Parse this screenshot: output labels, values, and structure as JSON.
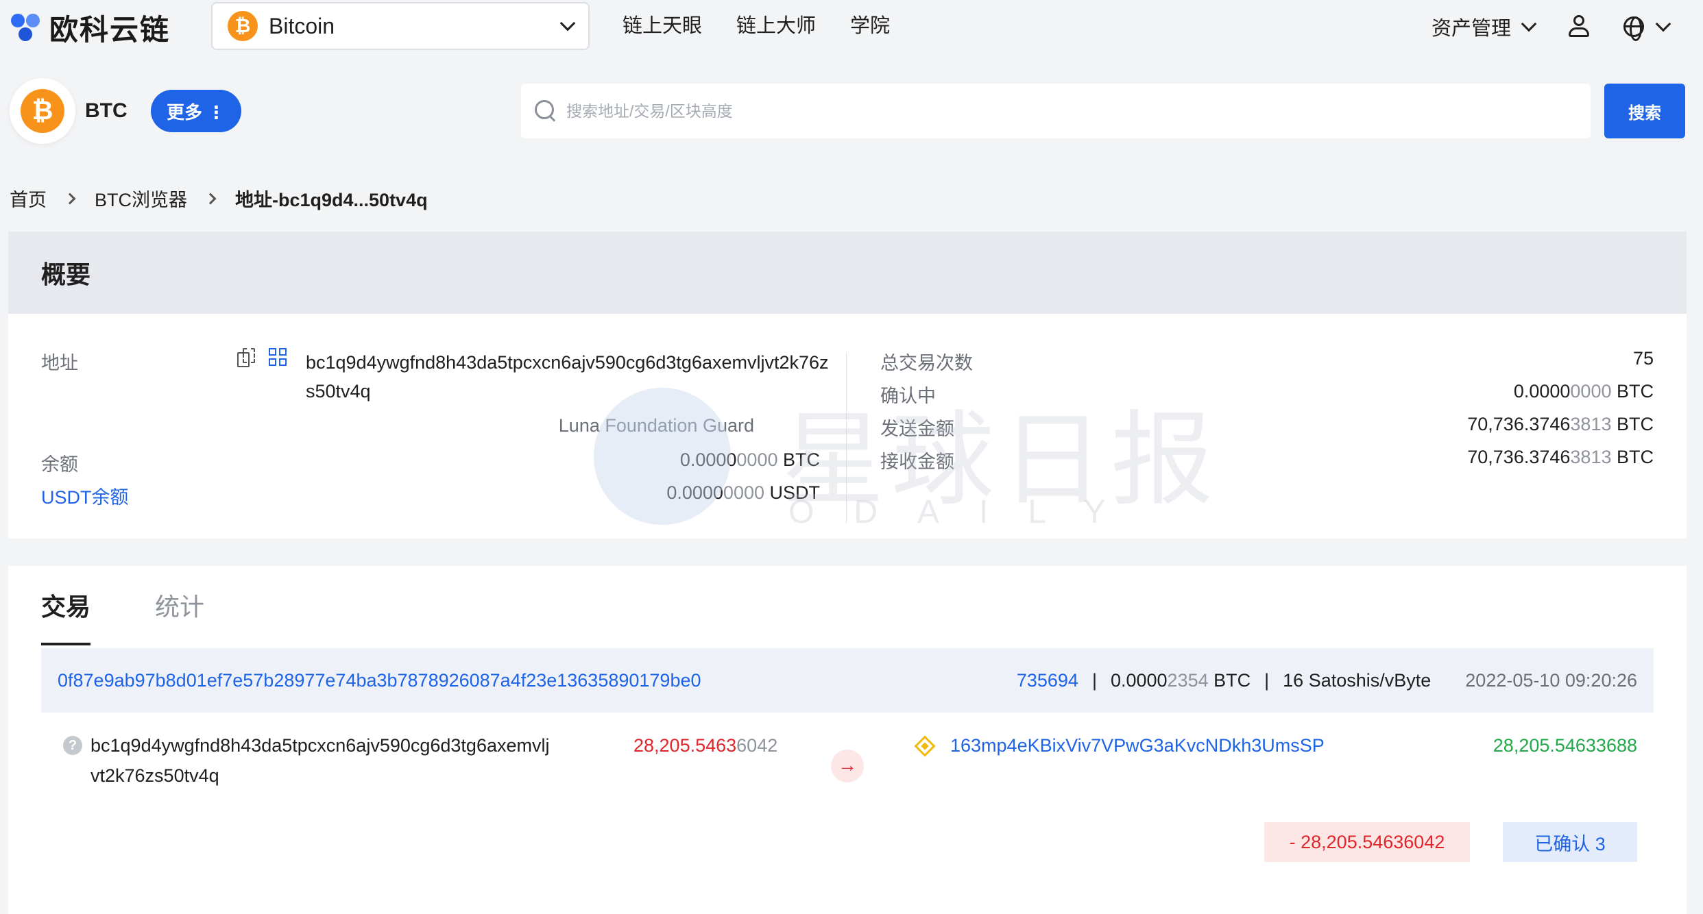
{
  "topbar": {
    "logo_text": "欧科云链",
    "chain_select": {
      "coin_glyph": "₿",
      "value": "Bitcoin"
    },
    "nav": [
      "链上天眼",
      "链上大师",
      "学院"
    ],
    "asset_mgmt": "资产管理"
  },
  "coin": {
    "glyph": "₿",
    "symbol": "BTC",
    "more_label": "更多 ⋮"
  },
  "search": {
    "placeholder": "搜索地址/交易/区块高度",
    "button_label": "搜索"
  },
  "breadcrumb": [
    "首页",
    "BTC浏览器",
    "地址-bc1q9d4...50tv4q"
  ],
  "overview": {
    "title": "概要",
    "address_label": "地址",
    "address": "bc1q9d4ywgfnd8h43da5tpcxcn6ajv590cg6d3tg6axemvljvt2k76zs50tv4q",
    "tag": "Luna Foundation Guard",
    "balance_label": "余额",
    "usdt_balance_label": "USDT余额",
    "balance_btc": {
      "main": "0.0000",
      "dim": "0000",
      "unit": " BTC"
    },
    "balance_usdt": {
      "main": "0.0000",
      "dim": "0000",
      "unit": " USDT"
    },
    "stats": [
      {
        "label": "总交易次数",
        "main": "75",
        "dim": "",
        "unit": ""
      },
      {
        "label": "确认中",
        "main": "0.0000",
        "dim": "0000",
        "unit": " BTC"
      },
      {
        "label": "发送金额",
        "main": "70,736.3746",
        "dim": "3813",
        "unit": " BTC"
      },
      {
        "label": "接收金额",
        "main": "70,736.3746",
        "dim": "3813",
        "unit": " BTC"
      }
    ]
  },
  "watermark": {
    "text": "星球日报",
    "sub": "ODAILY"
  },
  "transactions": {
    "tabs": [
      "交易",
      "统计"
    ],
    "items": [
      {
        "hash": "0f87e9ab97b8d01ef7e57b28977e74ba3b7878926087a4f23e13635890179be0",
        "block": "735694",
        "fee_main": "0.0000",
        "fee_dim": "2354",
        "fee_unit": " BTC",
        "fee_rate": "16 Satoshis/vByte",
        "time": "2022-05-10 09:20:26",
        "from_address": "bc1q9d4ywgfnd8h43da5tpcxcn6ajv590cg6d3tg6axemvljvt2k76zs50tv4q",
        "from_amount_main": "28,205.5463",
        "from_amount_dim": "6042",
        "arrow": "→",
        "to_address": "163mp4eKBixViv7VPwG3aKvcNDkh3UmsSP",
        "to_amount": "28,205.54633688",
        "net_amount": "- 28,205.54636042",
        "status": "已确认 3"
      }
    ]
  },
  "colors": {
    "accent": "#1f64e6",
    "btc": "#f7931a",
    "negative": "#e0262b",
    "positive": "#22a94a"
  }
}
